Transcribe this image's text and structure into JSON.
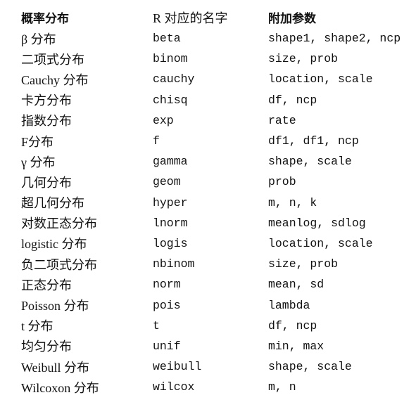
{
  "table": {
    "headers": [
      "概率分布",
      "R 对应的名字",
      "附加参数"
    ],
    "rows": [
      {
        "distribution": "β 分布",
        "r_name": "beta",
        "params": "shape1, shape2, ncp"
      },
      {
        "distribution": "二项式分布",
        "r_name": "binom",
        "params": "size, prob"
      },
      {
        "distribution": "Cauchy 分布",
        "r_name": "cauchy",
        "params": "location, scale"
      },
      {
        "distribution": "卡方分布",
        "r_name": "chisq",
        "params": "df, ncp"
      },
      {
        "distribution": "指数分布",
        "r_name": "exp",
        "params": "rate"
      },
      {
        "distribution": "F分布",
        "r_name": "f",
        "params": "df1, df1, ncp"
      },
      {
        "distribution": "γ 分布",
        "r_name": "gamma",
        "params": "shape, scale"
      },
      {
        "distribution": "几何分布",
        "r_name": "geom",
        "params": "prob"
      },
      {
        "distribution": "超几何分布",
        "r_name": "hyper",
        "params": "m, n, k"
      },
      {
        "distribution": "对数正态分布",
        "r_name": "lnorm",
        "params": "meanlog, sdlog"
      },
      {
        "distribution": "logistic 分布",
        "r_name": "logis",
        "params": "location, scale"
      },
      {
        "distribution": "负二项式分布",
        "r_name": "nbinom",
        "params": "size, prob"
      },
      {
        "distribution": "正态分布",
        "r_name": "norm",
        "params": "mean, sd"
      },
      {
        "distribution": "Poisson 分布",
        "r_name": "pois",
        "params": "lambda"
      },
      {
        "distribution": "t 分布",
        "r_name": "t",
        "params": "df, ncp"
      },
      {
        "distribution": "均匀分布",
        "r_name": "unif",
        "params": "min, max"
      },
      {
        "distribution": "Weibull 分布",
        "r_name": "weibull",
        "params": "shape, scale"
      },
      {
        "distribution": "Wilcoxon 分布",
        "r_name": "wilcox",
        "params": "m, n"
      }
    ]
  }
}
